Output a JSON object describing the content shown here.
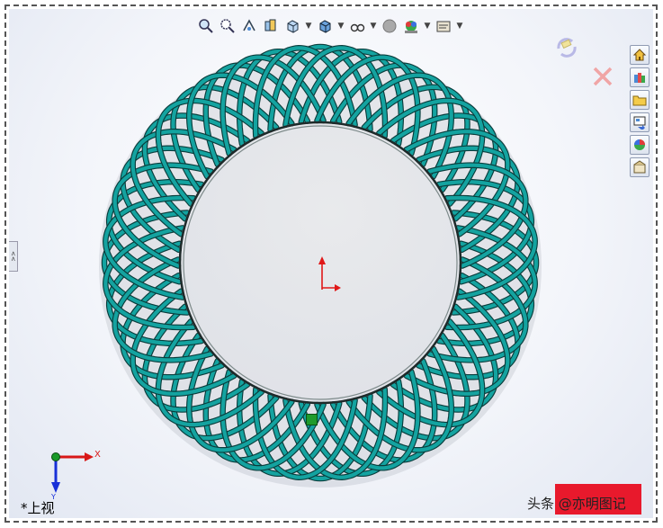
{
  "view": {
    "label": "*上视"
  },
  "axes": {
    "x_label": "X",
    "y_label": "Y"
  },
  "watermark": {
    "text": "头条 @亦明图记"
  },
  "model": {
    "lobes": 28,
    "ring_color": "#14a3a0",
    "edge_color": "#0a3d3c"
  },
  "toolbar": {
    "items": [
      {
        "name": "zoom-to-fit-icon"
      },
      {
        "name": "zoom-to-area-icon"
      },
      {
        "name": "previous-view-icon"
      },
      {
        "name": "section-view-icon"
      },
      {
        "name": "view-orientation-icon",
        "dropdown": true
      },
      {
        "name": "display-style-icon",
        "dropdown": true
      },
      {
        "name": "hide-show-items-icon",
        "dropdown": true
      },
      {
        "name": "edit-appearance-icon"
      },
      {
        "name": "apply-scene-icon",
        "dropdown": true
      },
      {
        "name": "view-settings-icon",
        "dropdown": true
      }
    ]
  },
  "right_panel": {
    "items": [
      {
        "name": "resources-icon"
      },
      {
        "name": "design-library-icon"
      },
      {
        "name": "file-explorer-icon"
      },
      {
        "name": "view-palette-icon"
      },
      {
        "name": "appearances-icon"
      },
      {
        "name": "custom-properties-icon"
      }
    ]
  }
}
